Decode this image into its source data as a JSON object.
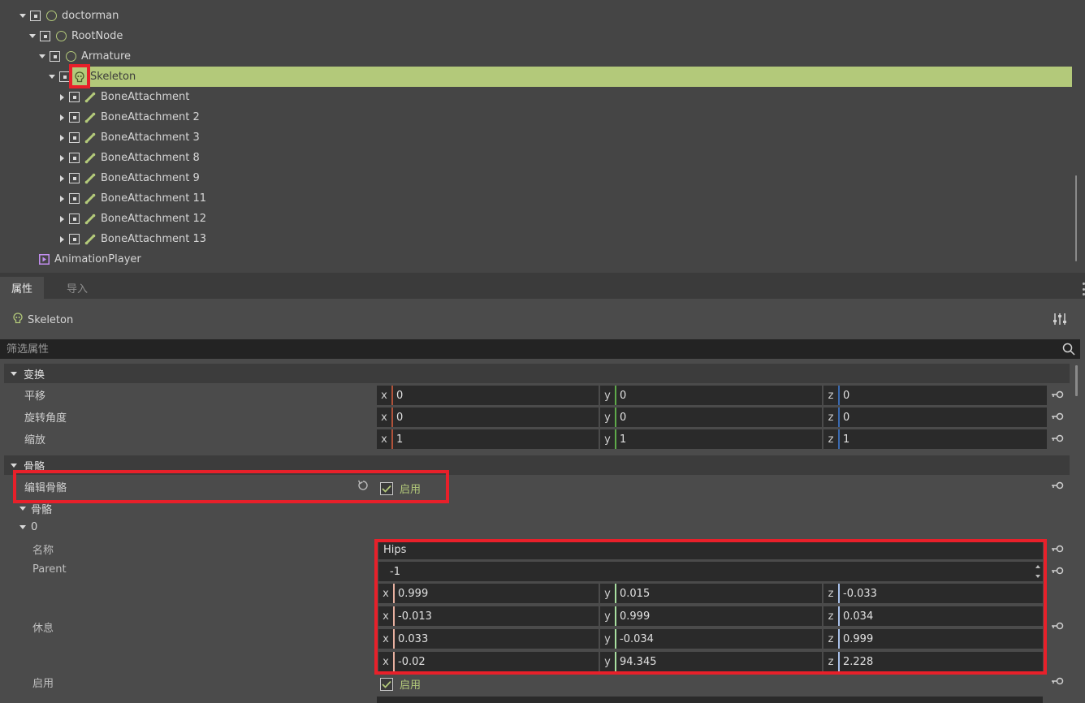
{
  "tree": {
    "nodes": [
      {
        "label": "doctorman",
        "icon": "node-circle-icon",
        "expanded": true
      },
      {
        "label": "RootNode",
        "icon": "node-circle-icon",
        "expanded": true
      },
      {
        "label": "Armature",
        "icon": "node-circle-icon",
        "expanded": true
      },
      {
        "label": "Skeleton",
        "icon": "skeleton-icon",
        "expanded": true,
        "selected": true
      },
      {
        "label": "BoneAttachment",
        "icon": "bone-attachment-icon"
      },
      {
        "label": "BoneAttachment 2",
        "icon": "bone-attachment-icon"
      },
      {
        "label": "BoneAttachment 3",
        "icon": "bone-attachment-icon"
      },
      {
        "label": "BoneAttachment 8",
        "icon": "bone-attachment-icon"
      },
      {
        "label": "BoneAttachment 9",
        "icon": "bone-attachment-icon"
      },
      {
        "label": "BoneAttachment 11",
        "icon": "bone-attachment-icon"
      },
      {
        "label": "BoneAttachment 12",
        "icon": "bone-attachment-icon"
      },
      {
        "label": "BoneAttachment 13",
        "icon": "bone-attachment-icon"
      },
      {
        "label": "AnimationPlayer",
        "icon": "animation-player-icon"
      }
    ]
  },
  "tabs": {
    "properties": "属性",
    "import": "导入"
  },
  "inspector": {
    "object_name": "Skeleton",
    "filter_placeholder": "筛选属性",
    "transform": {
      "section": "变换",
      "translation": {
        "label": "平移",
        "x": "0",
        "y": "0",
        "z": "0"
      },
      "rotation": {
        "label": "旋转角度",
        "x": "0",
        "y": "0",
        "z": "0"
      },
      "scale": {
        "label": "缩放",
        "x": "1",
        "y": "1",
        "z": "1"
      }
    },
    "skeleton": {
      "section": "骨骼",
      "edit_bones_label": "编辑骨骼",
      "edit_bones_checkbox": "启用",
      "bones_group": "骨骼",
      "bone_index": "0",
      "name_label": "名称",
      "name_value": "Hips",
      "parent_label": "Parent",
      "parent_value": "-1",
      "rest_label": "休息",
      "rest_rows": [
        {
          "x": "0.999",
          "y": "0.015",
          "z": "-0.033"
        },
        {
          "x": "-0.013",
          "y": "0.999",
          "z": "0.034"
        },
        {
          "x": "0.033",
          "y": "-0.034",
          "z": "0.999"
        },
        {
          "x": "-0.02",
          "y": "94.345",
          "z": "2.228"
        }
      ],
      "enabled_label": "启用",
      "enabled_checkbox": "启用"
    }
  },
  "colors": {
    "accent": "#b3c97a",
    "highlight": "#e8202a",
    "axis_x": "#b0523a",
    "axis_y": "#5faa4a",
    "axis_z": "#3a6ab0"
  },
  "axis_labels": {
    "x": "x",
    "y": "y",
    "z": "z"
  }
}
